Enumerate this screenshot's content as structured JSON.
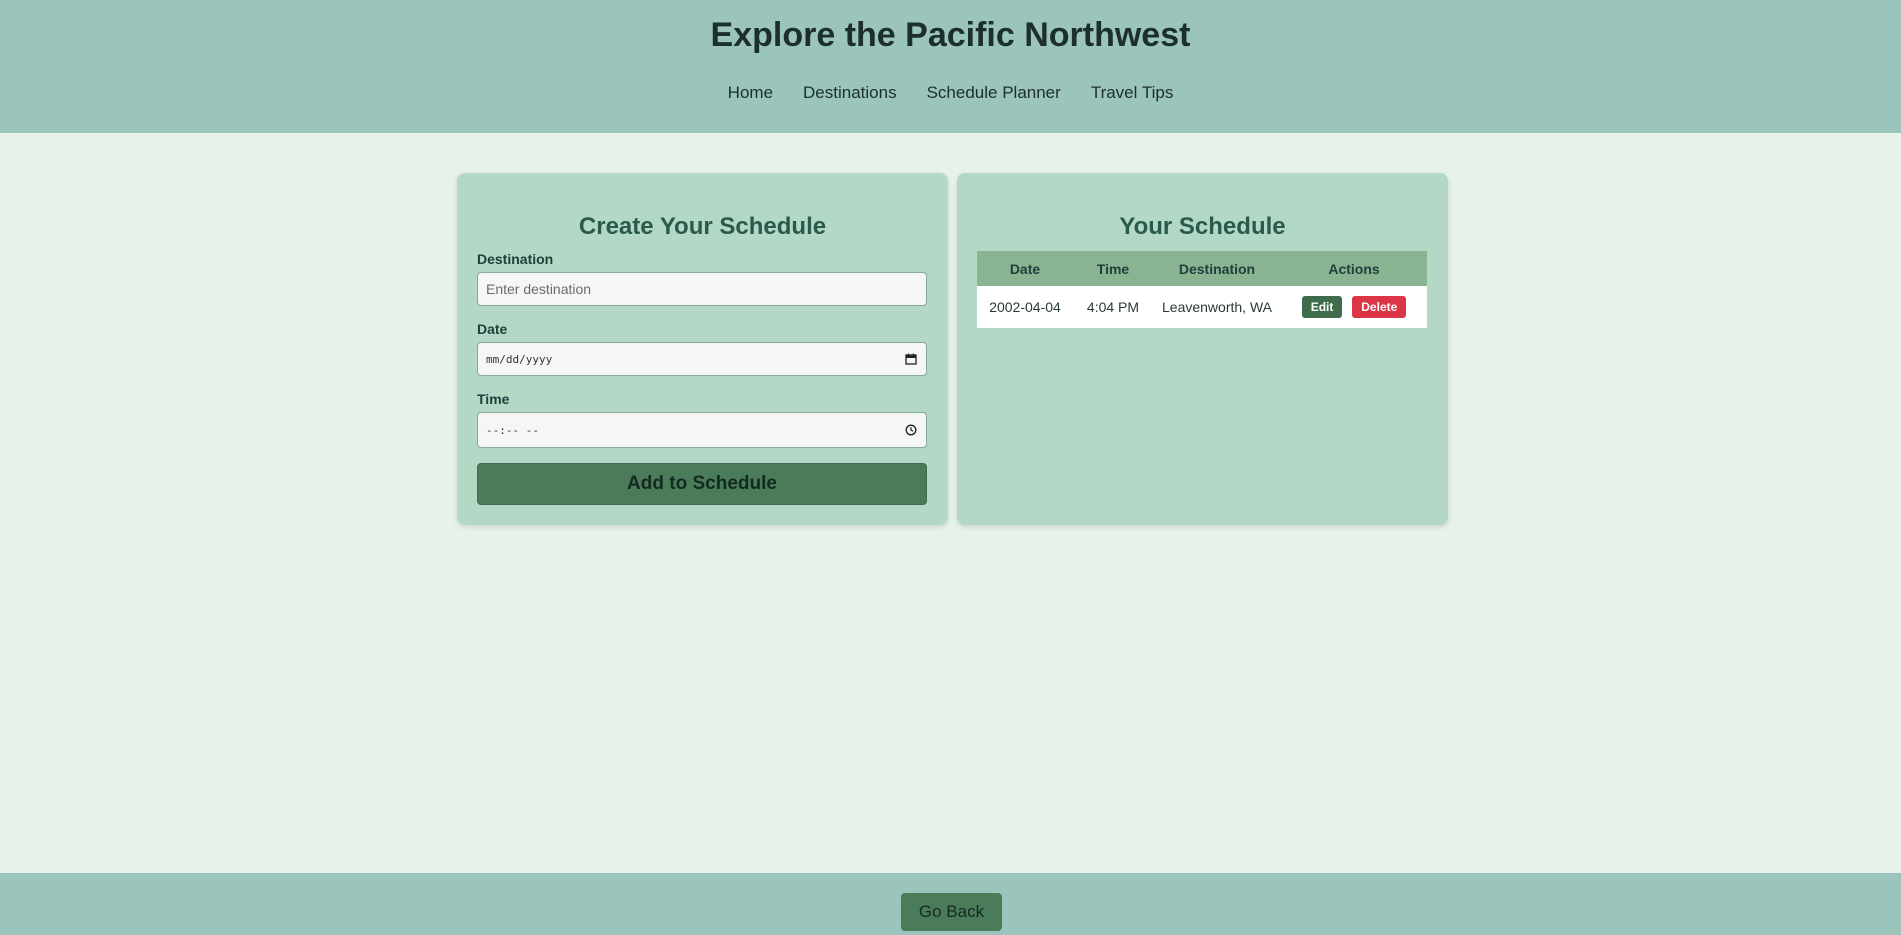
{
  "header": {
    "title": "Explore the Pacific Northwest",
    "nav": [
      "Home",
      "Destinations",
      "Schedule Planner",
      "Travel Tips"
    ]
  },
  "form": {
    "title": "Create Your Schedule",
    "destination_label": "Destination",
    "destination_placeholder": "Enter destination",
    "date_label": "Date",
    "date_value": "mm/dd/yyyy",
    "time_label": "Time",
    "time_value": "--:-- --",
    "submit_label": "Add to Schedule"
  },
  "schedule": {
    "title": "Your Schedule",
    "columns": [
      "Date",
      "Time",
      "Destination",
      "Actions"
    ],
    "rows": [
      {
        "date": "2002-04-04",
        "time": "4:04 PM",
        "destination": "Leavenworth, WA",
        "edit_label": "Edit",
        "delete_label": "Delete"
      }
    ]
  },
  "footer": {
    "go_back_label": "Go Back"
  },
  "colors": {
    "header_bg": "#9ac4bc",
    "page_bg": "#e7f2ea",
    "panel_bg": "#b4d8c6",
    "primary_button": "#4a7c5a",
    "delete_button": "#dc3545"
  }
}
